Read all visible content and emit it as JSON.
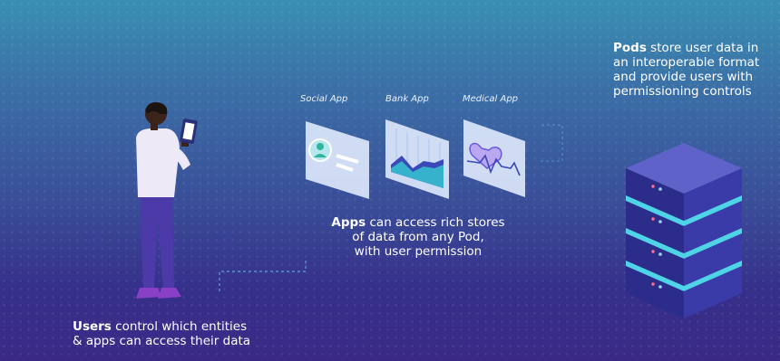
{
  "captions": {
    "pods": {
      "bold": "Pods",
      "line1": " store user data in",
      "line2": "an interoperable format",
      "line3": "and provide users with",
      "line4": "permissioning controls"
    },
    "apps": {
      "bold": "Apps",
      "line1": " can access rich stores",
      "line2": "of data from any Pod,",
      "line3": "with user permission"
    },
    "users": {
      "bold": "Users",
      "line1": " control which entities",
      "line2": "& apps can access their data"
    }
  },
  "app_labels": [
    "Social App",
    "Bank App",
    "Medical App"
  ],
  "colors": {
    "accent_teal": "#4fd3e6",
    "server_top": "#5e62c9",
    "server_side": "#2c2c8a",
    "card_bg": "#dce7fb"
  },
  "icons": [
    "person-icon",
    "chart-icon",
    "heart-icon",
    "server-icon"
  ]
}
